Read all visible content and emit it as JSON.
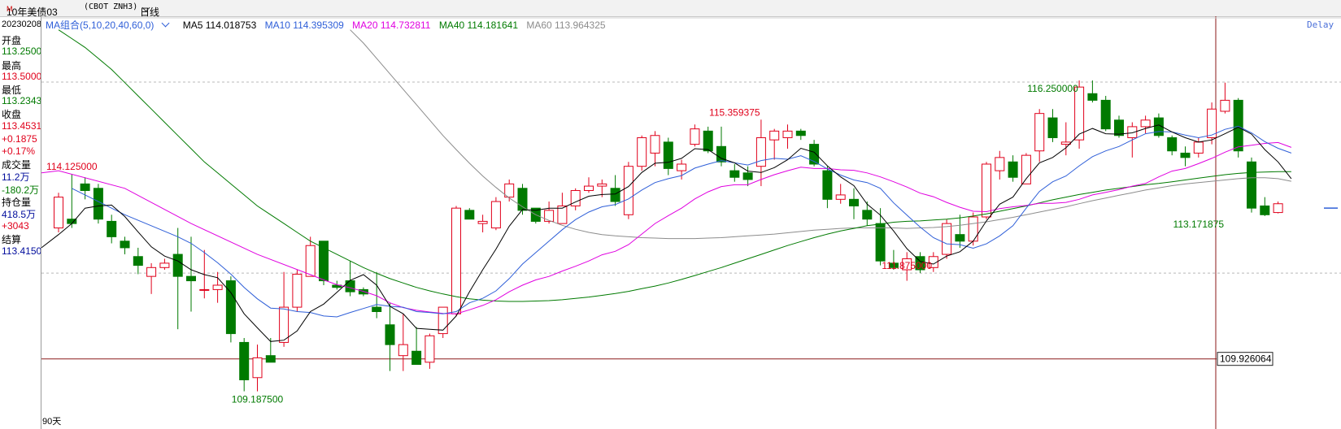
{
  "header": {
    "symbol": "10年美债03",
    "symbol_mark": "M",
    "code": "(CBOT ZNH3)",
    "period": "日线"
  },
  "info": {
    "date": "20230208",
    "open_label": "开盘",
    "open": "113.2500",
    "high_label": "最高",
    "high": "113.5000",
    "low_label": "最低",
    "low": "113.2343",
    "close_label": "收盘",
    "close": "113.4531",
    "change": "+0.1875",
    "change_pct": "+0.17%",
    "volume_label": "成交量",
    "volume": "11.2万",
    "volume_change": "-180.2万",
    "oi_label": "持仓量",
    "oi": "418.5万",
    "oi_change": "+3043",
    "settle_label": "结算",
    "settle": "113.4150"
  },
  "legend": {
    "group": "MA组合(5,10,20,40,60,0)",
    "ma5": "MA5 114.018753",
    "ma10": "MA10 114.395309",
    "ma20": "MA20 114.732811",
    "ma40": "MA40 114.181641",
    "ma60": "MA60 113.964325"
  },
  "delay": "Delay",
  "range_label": "90天",
  "colors": {
    "up": "#e0001b",
    "down": "#007a00",
    "ma5": "#000000",
    "ma10": "#2f5fd8",
    "ma20": "#e000e0",
    "ma40": "#007a00",
    "ma60": "#8c8c8c"
  },
  "chart_data": {
    "type": "candlestick",
    "ylim": [
      108.85,
      117.45
    ],
    "price_tag": "109.926064",
    "price_tag_value": 109.926064,
    "annotations": [
      {
        "text": "114.125000",
        "index": 1,
        "value": 114.125
      },
      {
        "text": "109.187500",
        "index": 15,
        "value": 109.1875
      },
      {
        "text": "115.359375",
        "index": 51,
        "value": 115.359375
      },
      {
        "text": "111.875000",
        "index": 64,
        "value": 111.875
      },
      {
        "text": "116.250000",
        "index": 75,
        "value": 116.25
      },
      {
        "text": "113.171875",
        "index": 86,
        "value": 113.171875
      }
    ],
    "candles": [
      {
        "o": 112.9,
        "h": 113.7,
        "l": 112.8,
        "c": 113.6
      },
      {
        "o": 113.1,
        "h": 114.125,
        "l": 112.9,
        "c": 113.0
      },
      {
        "o": 113.9,
        "h": 114.05,
        "l": 113.55,
        "c": 113.75
      },
      {
        "o": 113.8,
        "h": 113.9,
        "l": 113.0,
        "c": 113.1
      },
      {
        "o": 113.05,
        "h": 113.2,
        "l": 112.55,
        "c": 112.7
      },
      {
        "o": 112.6,
        "h": 112.7,
        "l": 112.3,
        "c": 112.45
      },
      {
        "o": 112.25,
        "h": 112.45,
        "l": 111.85,
        "c": 112.05
      },
      {
        "o": 111.8,
        "h": 112.1,
        "l": 111.4,
        "c": 112.0
      },
      {
        "o": 112.0,
        "h": 112.2,
        "l": 111.95,
        "c": 112.1
      },
      {
        "o": 112.3,
        "h": 112.9,
        "l": 110.6,
        "c": 111.8
      },
      {
        "o": 111.8,
        "h": 112.7,
        "l": 111.0,
        "c": 111.7
      },
      {
        "o": 111.5,
        "h": 112.4,
        "l": 111.3,
        "c": 111.5
      },
      {
        "o": 111.5,
        "h": 111.9,
        "l": 111.2,
        "c": 111.6
      },
      {
        "o": 111.7,
        "h": 111.8,
        "l": 110.3,
        "c": 110.5
      },
      {
        "o": 110.3,
        "h": 110.4,
        "l": 109.19,
        "c": 109.45
      },
      {
        "o": 109.5,
        "h": 110.25,
        "l": 109.19,
        "c": 109.95
      },
      {
        "o": 110.0,
        "h": 110.4,
        "l": 109.85,
        "c": 109.85
      },
      {
        "o": 110.3,
        "h": 111.9,
        "l": 110.2,
        "c": 111.1
      },
      {
        "o": 111.1,
        "h": 111.95,
        "l": 111.0,
        "c": 111.85
      },
      {
        "o": 111.8,
        "h": 112.7,
        "l": 111.8,
        "c": 112.5
      },
      {
        "o": 112.6,
        "h": 112.6,
        "l": 111.6,
        "c": 111.7
      },
      {
        "o": 111.6,
        "h": 111.7,
        "l": 111.5,
        "c": 111.55
      },
      {
        "o": 111.7,
        "h": 112.15,
        "l": 111.35,
        "c": 111.45
      },
      {
        "o": 111.5,
        "h": 111.55,
        "l": 111.35,
        "c": 111.4
      },
      {
        "o": 111.1,
        "h": 111.9,
        "l": 110.85,
        "c": 111.0
      },
      {
        "o": 110.7,
        "h": 111.2,
        "l": 109.65,
        "c": 110.25
      },
      {
        "o": 110.0,
        "h": 110.95,
        "l": 109.65,
        "c": 110.25
      },
      {
        "o": 110.1,
        "h": 110.65,
        "l": 109.8,
        "c": 109.8
      },
      {
        "o": 109.85,
        "h": 110.5,
        "l": 109.7,
        "c": 110.45
      },
      {
        "o": 110.5,
        "h": 111.1,
        "l": 110.4,
        "c": 111.1
      },
      {
        "o": 110.95,
        "h": 113.4,
        "l": 110.9,
        "c": 113.35
      },
      {
        "o": 113.3,
        "h": 113.35,
        "l": 113.1,
        "c": 113.1
      },
      {
        "o": 113.0,
        "h": 113.2,
        "l": 112.8,
        "c": 113.05
      },
      {
        "o": 112.9,
        "h": 113.6,
        "l": 112.85,
        "c": 113.5
      },
      {
        "o": 113.6,
        "h": 114.0,
        "l": 113.5,
        "c": 113.9
      },
      {
        "o": 113.8,
        "h": 113.9,
        "l": 113.2,
        "c": 113.3
      },
      {
        "o": 113.35,
        "h": 113.35,
        "l": 113.0,
        "c": 113.05
      },
      {
        "o": 113.05,
        "h": 113.5,
        "l": 113.0,
        "c": 113.3
      },
      {
        "o": 113.0,
        "h": 113.7,
        "l": 113.0,
        "c": 113.4
      },
      {
        "o": 113.4,
        "h": 113.8,
        "l": 113.3,
        "c": 113.75
      },
      {
        "o": 113.75,
        "h": 114.05,
        "l": 113.7,
        "c": 113.85
      },
      {
        "o": 113.85,
        "h": 114.0,
        "l": 113.6,
        "c": 113.9
      },
      {
        "o": 113.8,
        "h": 114.1,
        "l": 113.4,
        "c": 113.5
      },
      {
        "o": 113.2,
        "h": 114.4,
        "l": 113.1,
        "c": 114.3
      },
      {
        "o": 114.3,
        "h": 115.0,
        "l": 114.2,
        "c": 114.95
      },
      {
        "o": 114.6,
        "h": 115.1,
        "l": 114.3,
        "c": 115.0
      },
      {
        "o": 114.85,
        "h": 114.95,
        "l": 114.1,
        "c": 114.25
      },
      {
        "o": 114.2,
        "h": 114.45,
        "l": 114.0,
        "c": 114.35
      },
      {
        "o": 114.8,
        "h": 115.25,
        "l": 114.75,
        "c": 115.15
      },
      {
        "o": 115.1,
        "h": 115.2,
        "l": 114.6,
        "c": 114.65
      },
      {
        "o": 114.75,
        "h": 115.2,
        "l": 114.3,
        "c": 114.4
      },
      {
        "o": 114.2,
        "h": 114.35,
        "l": 113.95,
        "c": 114.05
      },
      {
        "o": 114.15,
        "h": 114.3,
        "l": 113.85,
        "c": 114.0
      },
      {
        "o": 114.3,
        "h": 115.36,
        "l": 113.85,
        "c": 114.95
      },
      {
        "o": 114.9,
        "h": 115.15,
        "l": 114.45,
        "c": 115.1
      },
      {
        "o": 114.95,
        "h": 115.25,
        "l": 114.7,
        "c": 115.1
      },
      {
        "o": 115.1,
        "h": 115.15,
        "l": 114.9,
        "c": 115.0
      },
      {
        "o": 114.8,
        "h": 114.9,
        "l": 114.3,
        "c": 114.35
      },
      {
        "o": 114.2,
        "h": 114.3,
        "l": 113.35,
        "c": 113.55
      },
      {
        "o": 113.55,
        "h": 113.9,
        "l": 113.45,
        "c": 113.65
      },
      {
        "o": 113.55,
        "h": 113.8,
        "l": 113.1,
        "c": 113.4
      },
      {
        "o": 113.3,
        "h": 113.5,
        "l": 112.95,
        "c": 113.1
      },
      {
        "o": 113.0,
        "h": 113.35,
        "l": 112.05,
        "c": 112.15
      },
      {
        "o": 112.1,
        "h": 112.4,
        "l": 111.95,
        "c": 112.0
      },
      {
        "o": 111.95,
        "h": 112.35,
        "l": 111.7,
        "c": 112.2
      },
      {
        "o": 112.25,
        "h": 112.35,
        "l": 111.875,
        "c": 111.95
      },
      {
        "o": 112.0,
        "h": 112.35,
        "l": 111.9,
        "c": 112.25
      },
      {
        "o": 112.3,
        "h": 113.1,
        "l": 112.2,
        "c": 113.0
      },
      {
        "o": 112.75,
        "h": 113.2,
        "l": 112.45,
        "c": 112.6
      },
      {
        "o": 112.6,
        "h": 113.25,
        "l": 112.5,
        "c": 113.15
      },
      {
        "o": 113.15,
        "h": 114.4,
        "l": 113.1,
        "c": 114.35
      },
      {
        "o": 114.2,
        "h": 114.65,
        "l": 114.0,
        "c": 114.5
      },
      {
        "o": 114.4,
        "h": 114.55,
        "l": 113.95,
        "c": 114.05
      },
      {
        "o": 113.9,
        "h": 114.6,
        "l": 113.9,
        "c": 114.55
      },
      {
        "o": 114.65,
        "h": 115.6,
        "l": 114.4,
        "c": 115.5
      },
      {
        "o": 115.4,
        "h": 115.6,
        "l": 114.85,
        "c": 114.95
      },
      {
        "o": 114.8,
        "h": 115.3,
        "l": 114.55,
        "c": 114.85
      },
      {
        "o": 114.9,
        "h": 116.25,
        "l": 114.7,
        "c": 116.1
      },
      {
        "o": 115.95,
        "h": 116.25,
        "l": 115.75,
        "c": 115.8
      },
      {
        "o": 115.8,
        "h": 115.9,
        "l": 115.1,
        "c": 115.15
      },
      {
        "o": 115.35,
        "h": 115.45,
        "l": 114.95,
        "c": 115.0
      },
      {
        "o": 114.95,
        "h": 115.3,
        "l": 114.5,
        "c": 115.2
      },
      {
        "o": 115.2,
        "h": 115.45,
        "l": 115.05,
        "c": 115.35
      },
      {
        "o": 115.4,
        "h": 115.5,
        "l": 114.95,
        "c": 115.0
      },
      {
        "o": 114.95,
        "h": 115.0,
        "l": 114.55,
        "c": 114.65
      },
      {
        "o": 114.6,
        "h": 114.75,
        "l": 114.3,
        "c": 114.5
      },
      {
        "o": 114.6,
        "h": 114.95,
        "l": 114.5,
        "c": 114.85
      },
      {
        "o": 114.95,
        "h": 115.75,
        "l": 114.8,
        "c": 115.6
      },
      {
        "o": 115.55,
        "h": 116.2,
        "l": 115.5,
        "c": 115.8
      },
      {
        "o": 115.8,
        "h": 115.85,
        "l": 114.5,
        "c": 114.65
      },
      {
        "o": 114.4,
        "h": 114.5,
        "l": 113.25,
        "c": 113.35
      },
      {
        "o": 113.4,
        "h": 113.6,
        "l": 113.17,
        "c": 113.2
      },
      {
        "o": 113.25,
        "h": 113.5,
        "l": 113.23,
        "c": 113.45
      }
    ],
    "ma5": [
      null,
      null,
      null,
      null,
      113.42,
      113.16,
      112.81,
      112.47,
      112.26,
      112.15,
      111.95,
      111.84,
      111.77,
      111.43,
      110.95,
      110.63,
      110.32,
      110.35,
      110.56,
      111.0,
      111.17,
      111.44,
      111.71,
      111.84,
      111.6,
      111.12,
      110.95,
      110.62,
      110.6,
      110.58,
      110.9,
      111.45,
      111.95,
      112.42,
      112.94,
      113.32,
      113.3,
      113.35,
      113.35,
      113.49,
      113.62,
      113.66,
      113.67,
      113.84,
      114.16,
      114.37,
      114.39,
      114.48,
      114.7,
      114.68,
      114.48,
      114.38,
      114.19,
      114.16,
      114.27,
      114.45,
      114.71,
      114.62,
      114.31,
      114.06,
      113.86,
      113.44,
      113.19,
      112.83,
      112.43,
      112.14,
      112.08,
      112.26,
      112.36,
      112.6,
      113.06,
      113.44,
      113.6,
      114.02,
      114.38,
      114.5,
      114.72,
      115.03,
      115.16,
      115.04,
      115.03,
      115.06,
      115.16,
      115.24,
      115.08,
      114.95,
      114.85,
      114.9,
      115.04,
      115.19,
      115.03,
      114.68,
      114.4,
      114.02
    ],
    "ma10": [
      null,
      null,
      null,
      null,
      null,
      null,
      null,
      null,
      null,
      112.7,
      112.55,
      112.34,
      112.11,
      111.85,
      111.55,
      111.29,
      111.08,
      111.06,
      111.0,
      110.98,
      110.9,
      110.88,
      110.98,
      111.07,
      111.16,
      111.12,
      111.1,
      111.0,
      110.98,
      110.95,
      111.0,
      111.2,
      111.3,
      111.47,
      111.75,
      112.08,
      112.34,
      112.6,
      112.86,
      113.09,
      113.26,
      113.38,
      113.43,
      113.56,
      113.76,
      113.93,
      114.02,
      114.09,
      114.26,
      114.35,
      114.43,
      114.38,
      114.33,
      114.43,
      114.48,
      114.46,
      114.54,
      114.41,
      114.24,
      114.1,
      113.99,
      113.93,
      113.8,
      113.47,
      113.19,
      112.92,
      112.68,
      112.54,
      112.52,
      112.44,
      112.54,
      112.72,
      112.95,
      113.35,
      113.73,
      113.95,
      114.08,
      114.31,
      114.52,
      114.65,
      114.75,
      114.9,
      115.04,
      115.09,
      115.08,
      115.01,
      114.95,
      115.01,
      115.14,
      115.21,
      115.06,
      114.86,
      114.71,
      114.6
    ],
    "ma20": [
      null,
      null,
      null,
      null,
      null,
      null,
      null,
      null,
      null,
      null,
      null,
      null,
      null,
      null,
      null,
      null,
      null,
      null,
      null,
      111.84,
      111.72,
      111.61,
      111.54,
      111.46,
      111.36,
      111.2,
      111.09,
      111.03,
      110.99,
      110.96,
      110.95,
      111.04,
      111.14,
      111.27,
      111.45,
      111.6,
      111.72,
      111.8,
      111.92,
      112.03,
      112.15,
      112.29,
      112.37,
      112.52,
      112.76,
      113.0,
      113.18,
      113.35,
      113.56,
      113.72,
      113.84,
      113.88,
      113.88,
      114.0,
      114.11,
      114.2,
      114.28,
      114.25,
      114.25,
      114.22,
      114.21,
      114.15,
      114.06,
      113.95,
      113.83,
      113.69,
      113.61,
      113.48,
      113.37,
      113.28,
      113.27,
      113.34,
      113.38,
      113.41,
      113.46,
      113.46,
      113.48,
      113.55,
      113.65,
      113.71,
      113.77,
      113.85,
      113.91,
      114.06,
      114.19,
      114.25,
      114.36,
      114.48,
      114.62,
      114.74,
      114.78,
      114.82,
      114.84,
      114.73
    ],
    "ma40": [
      117.4,
      117.2,
      117.0,
      116.75,
      116.5,
      116.2,
      115.9,
      115.6,
      115.3,
      115.0,
      114.7,
      114.4,
      114.15,
      113.9,
      113.65,
      113.4,
      113.2,
      113.0,
      112.8,
      112.6,
      112.45,
      112.3,
      112.15,
      112.0,
      111.87,
      111.75,
      111.65,
      111.55,
      111.47,
      111.4,
      111.34,
      111.29,
      111.26,
      111.24,
      111.23,
      111.23,
      111.24,
      111.25,
      111.27,
      111.3,
      111.33,
      111.37,
      111.41,
      111.46,
      111.52,
      111.58,
      111.65,
      111.73,
      111.82,
      111.91,
      112.0,
      112.1,
      112.2,
      112.3,
      112.4,
      112.5,
      112.59,
      112.68,
      112.76,
      112.83,
      112.89,
      112.95,
      112.99,
      113.03,
      113.05,
      113.06,
      113.08,
      113.1,
      113.13,
      113.17,
      113.22,
      113.28,
      113.34,
      113.4,
      113.47,
      113.54,
      113.6,
      113.66,
      113.71,
      113.76,
      113.8,
      113.84,
      113.88,
      113.91,
      113.95,
      113.99,
      114.03,
      114.07,
      114.11,
      114.14,
      114.16,
      114.17,
      114.18,
      114.18
    ],
    "ma60": [
      null,
      null,
      null,
      null,
      null,
      null,
      null,
      null,
      null,
      null,
      null,
      null,
      null,
      null,
      null,
      null,
      null,
      null,
      null,
      null,
      null,
      null,
      117.4,
      117.1,
      116.75,
      116.4,
      116.05,
      115.7,
      115.35,
      115.0,
      114.68,
      114.37,
      114.08,
      113.82,
      113.58,
      113.38,
      113.2,
      113.07,
      112.96,
      112.87,
      112.8,
      112.75,
      112.72,
      112.7,
      112.68,
      112.67,
      112.66,
      112.66,
      112.66,
      112.67,
      112.68,
      112.7,
      112.72,
      112.74,
      112.76,
      112.79,
      112.82,
      112.85,
      112.87,
      112.89,
      112.9,
      112.9,
      112.9,
      112.9,
      112.89,
      112.9,
      112.91,
      112.93,
      112.96,
      113.0,
      113.04,
      113.09,
      113.14,
      113.2,
      113.26,
      113.32,
      113.38,
      113.45,
      113.52,
      113.58,
      113.64,
      113.7,
      113.76,
      113.81,
      113.86,
      113.9,
      113.93,
      113.96,
      113.99,
      114.02,
      114.04,
      114.04,
      114.02,
      113.96
    ]
  }
}
